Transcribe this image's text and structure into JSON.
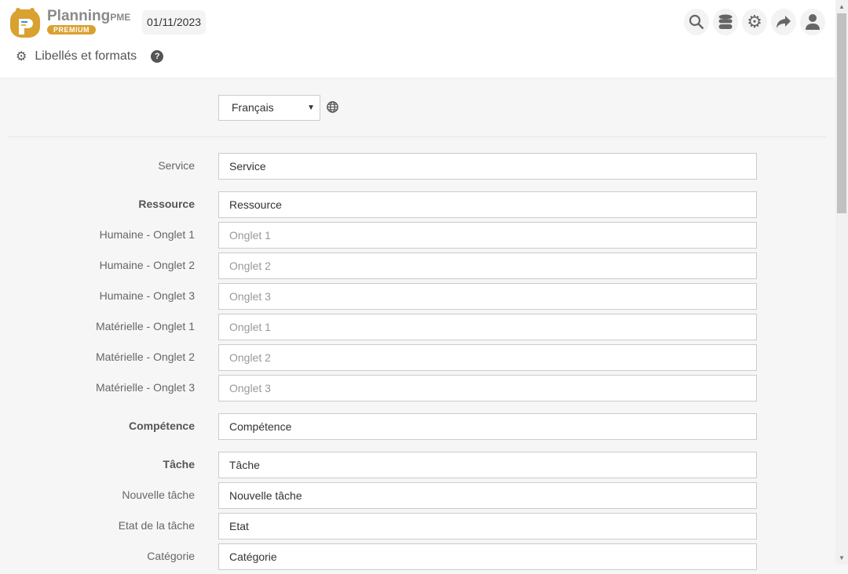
{
  "header": {
    "brand": "Planning",
    "brand_suffix": "PME",
    "badge": "PREMIUM",
    "date": "01/11/2023",
    "icons": [
      "search-icon",
      "database-icon",
      "gear-icon",
      "share-icon",
      "user-icon"
    ],
    "page_title": "Libellés et formats"
  },
  "language": {
    "selected": "Français"
  },
  "rows": [
    {
      "label": "Service",
      "value": "Service",
      "group": true
    },
    {
      "label": "Ressource",
      "value": "Ressource",
      "group": true
    },
    {
      "label": "Humaine - Onglet 1",
      "placeholder": "Onglet 1"
    },
    {
      "label": "Humaine - Onglet 2",
      "placeholder": "Onglet 2"
    },
    {
      "label": "Humaine - Onglet 3",
      "placeholder": "Onglet 3"
    },
    {
      "label": "Matérielle - Onglet 1",
      "placeholder": "Onglet 1"
    },
    {
      "label": "Matérielle - Onglet 2",
      "placeholder": "Onglet 2"
    },
    {
      "label": "Matérielle - Onglet 3",
      "placeholder": "Onglet 3"
    },
    {
      "label": "Compétence",
      "value": "Compétence",
      "group": true
    },
    {
      "label": "Tâche",
      "value": "Tâche",
      "group": true
    },
    {
      "label": "Nouvelle tâche",
      "value": "Nouvelle tâche"
    },
    {
      "label": "Etat de la tâche",
      "value": "Etat"
    },
    {
      "label": "Catégorie",
      "value": "Catégorie"
    }
  ]
}
